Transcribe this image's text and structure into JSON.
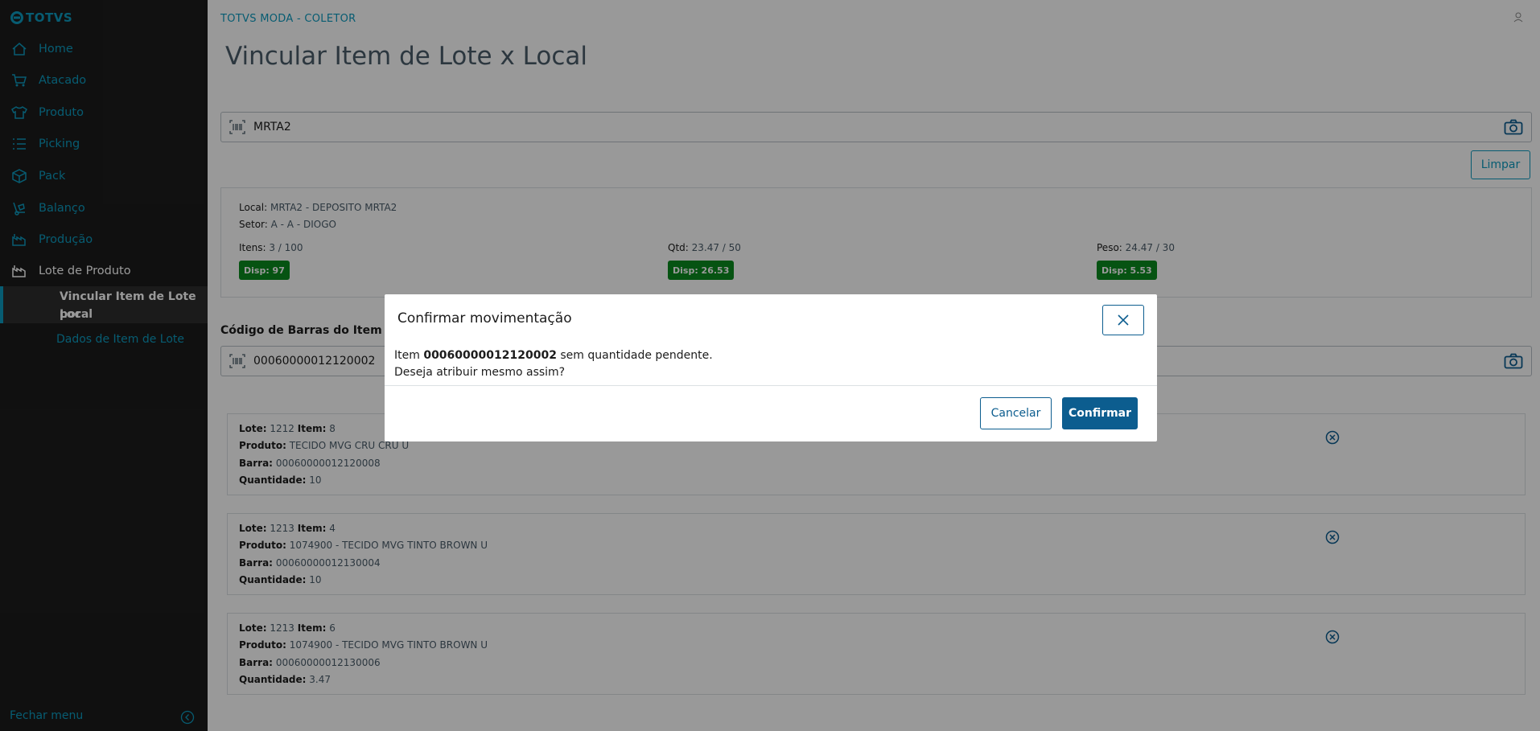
{
  "sidebar": {
    "brand": "TOTVS",
    "items": [
      {
        "label": "Home",
        "icon": "home-icon"
      },
      {
        "label": "Atacado",
        "icon": "cart-icon"
      },
      {
        "label": "Produto",
        "icon": "shirt-icon"
      },
      {
        "label": "Picking",
        "icon": "list-icon"
      },
      {
        "label": "Pack",
        "icon": "box-icon"
      },
      {
        "label": "Balanço",
        "icon": "hand-truck-icon"
      },
      {
        "label": "Produção",
        "icon": "factory-icon"
      },
      {
        "label": "Lote de Produto",
        "icon": "factory-icon"
      }
    ],
    "subitems": [
      {
        "label_line1": "Vincular Item de Lote por",
        "label_line2": "Local"
      },
      {
        "label_line1": "Dados de Item de Lote"
      }
    ],
    "footer": "Fechar menu"
  },
  "header": {
    "app_title": "TOTVS MODA - COLETOR",
    "page_title": "Vincular Item de Lote x Local"
  },
  "local_input": {
    "value": "MRTA2"
  },
  "limpar_label": "Limpar",
  "info": {
    "local_label": "Local:",
    "local_value": "MRTA2 - DEPOSITO MRTA2",
    "setor_label": "Setor:",
    "setor_value": "A - A - DIOGO",
    "itens_label": "Itens:",
    "itens_value": "3 / 100",
    "itens_disp": "Disp: 97",
    "qtd_label": "Qtd:",
    "qtd_value": "23.47 / 50",
    "qtd_disp": "Disp: 26.53",
    "peso_label": "Peso:",
    "peso_value": "24.47 / 30",
    "peso_disp": "Disp: 5.53"
  },
  "item_section": {
    "label": "Código de Barras do Item",
    "input_value": "00060000012120002"
  },
  "items": [
    {
      "lote": "1212",
      "item": "8",
      "produto": "TECIDO MVG CRU CRU U",
      "barra": "00060000012120008",
      "quantidade": "10"
    },
    {
      "lote": "1213",
      "item": "4",
      "produto": "1074900 - TECIDO MVG TINTO BROWN U",
      "barra": "00060000012130004",
      "quantidade": "10"
    },
    {
      "lote": "1213",
      "item": "6",
      "produto": "1074900 - TECIDO MVG TINTO BROWN U",
      "barra": "00060000012130006",
      "quantidade": "3.47"
    }
  ],
  "labels": {
    "lote": "Lote:",
    "item": "Item:",
    "produto": "Produto:",
    "barra": "Barra:",
    "quantidade": "Quantidade:"
  },
  "modal": {
    "title": "Confirmar movimentação",
    "prefix": "Item",
    "code": "00060000012120002",
    "suffix": "sem quantidade pendente.",
    "question": "Deseja atribuir mesmo assim?",
    "cancel": "Cancelar",
    "confirm": "Confirmar"
  },
  "colors": {
    "accent": "#0c9abe",
    "primary": "#0c5d8f",
    "success": "#0a8a1f",
    "sidebar": "#1c1c1c"
  }
}
